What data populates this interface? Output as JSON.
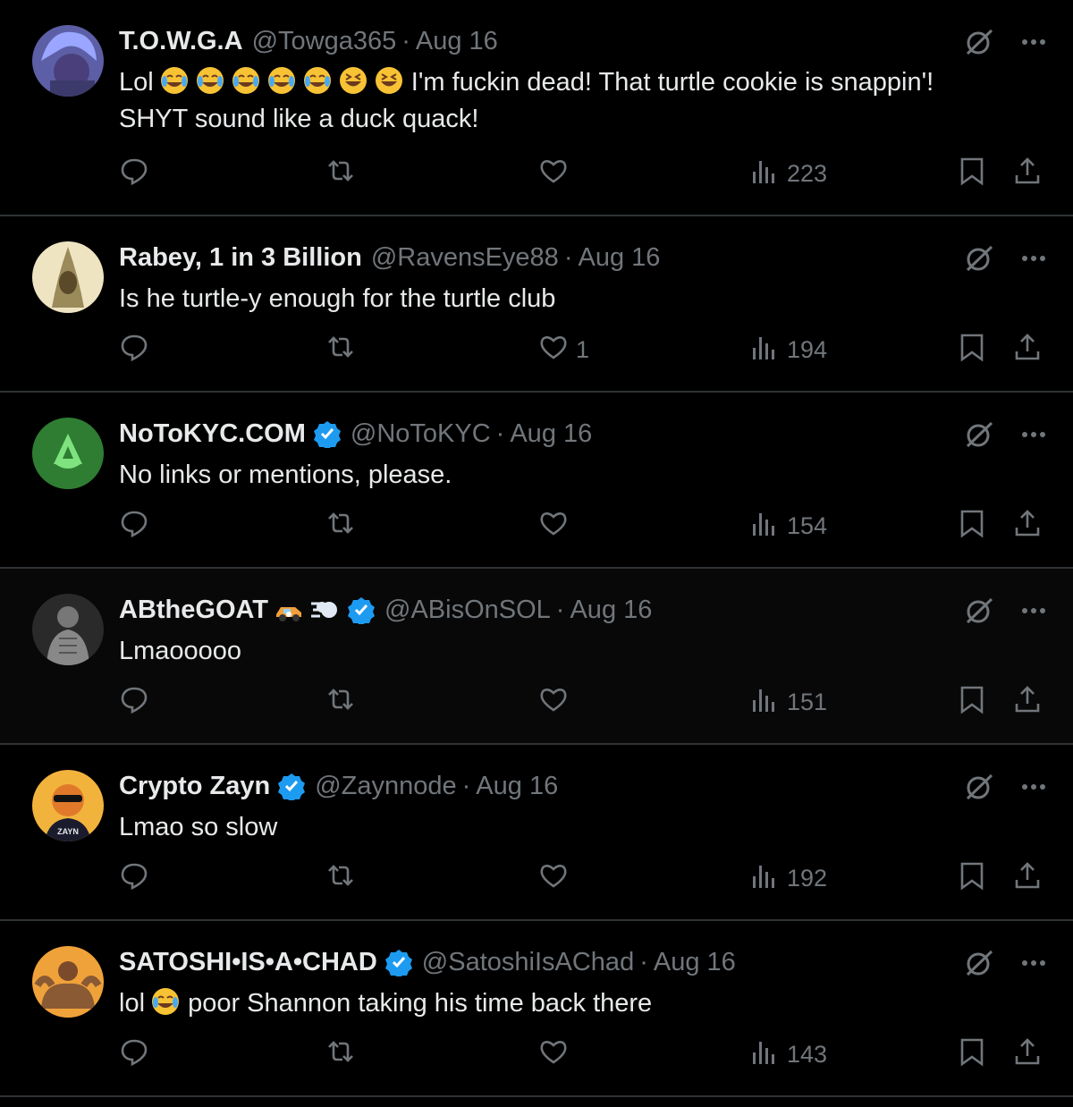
{
  "tweets": [
    {
      "name": "T.O.W.G.A",
      "handle": "@Towga365",
      "date": "Aug 16",
      "verified": false,
      "text_line1_prefix": "Lol",
      "text_line1_suffix": "I'm fuckin dead! That turtle cookie is snappin'!",
      "text_line2": "SHYT sound like a duck quack!",
      "emojis": [
        "face-with-tears-of-joy",
        "face-with-tears-of-joy",
        "face-with-tears-of-joy",
        "face-with-tears-of-joy",
        "face-with-tears-of-joy",
        "grinning-squinting-face",
        "grinning-squinting-face"
      ],
      "replies": "",
      "reposts": "",
      "likes": "",
      "views": "223",
      "avatar_color": "#6a6fb0"
    },
    {
      "name": "Rabey, 1 in 3 Billion",
      "handle": "@RavensEye88",
      "date": "Aug 16",
      "verified": false,
      "text": "Is he turtle-y enough for the turtle club",
      "replies": "",
      "reposts": "",
      "likes": "1",
      "views": "194",
      "avatar_color": "#e8dcb6"
    },
    {
      "name": "NoToKYC.COM",
      "handle": "@NoToKYC",
      "date": "Aug 16",
      "verified": true,
      "text": "No links or mentions, please.",
      "replies": "",
      "reposts": "",
      "likes": "",
      "views": "154",
      "avatar_color": "#2e7d32"
    },
    {
      "name": "ABtheGOAT",
      "handle": "@ABisOnSOL",
      "date": "Aug 16",
      "verified": true,
      "name_emojis": [
        "race-car",
        "dashing-away"
      ],
      "text": "Lmaooooo",
      "replies": "",
      "reposts": "",
      "likes": "",
      "views": "151",
      "avatar_color": "#3a3a3a"
    },
    {
      "name": "Crypto Zayn",
      "handle": "@Zaynnode",
      "date": "Aug 16",
      "verified": true,
      "text": "Lmao so slow",
      "avatar_label": "ZAYN",
      "replies": "",
      "reposts": "",
      "likes": "",
      "views": "192",
      "avatar_color": "#f2b33d"
    },
    {
      "name": "SATOSHI•IS•A•CHAD",
      "handle": "@SatoshiIsAChad",
      "date": "Aug 16",
      "verified": true,
      "text_prefix": "lol",
      "text_suffix": "poor Shannon taking his time back there",
      "text_emoji": "face-with-tears-of-joy",
      "replies": "",
      "reposts": "",
      "likes": "",
      "views": "143",
      "avatar_color": "#f0a23a"
    }
  ],
  "colors": {
    "background": "#000000",
    "text": "#e7e9ea",
    "muted": "#71767b",
    "divider": "#2f3336",
    "verified": "#1d9bf0"
  },
  "dot": "·"
}
